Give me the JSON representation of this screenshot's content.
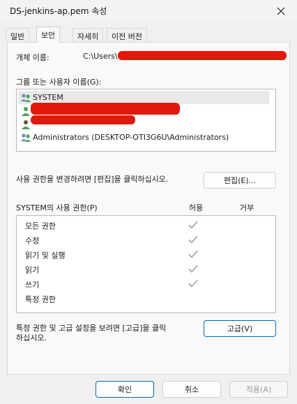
{
  "window": {
    "title": "DS-jenkins-ap.pem 속성"
  },
  "tabs": [
    {
      "label": "일반",
      "active": false
    },
    {
      "label": "보안",
      "active": true
    },
    {
      "label": "자세히",
      "active": false
    },
    {
      "label": "이전 버전",
      "active": false
    }
  ],
  "object_name": {
    "label": "개체 이름:",
    "value": "C:\\Users\\"
  },
  "groups": {
    "label": "그룹 또는 사용자 이름(G):",
    "items": [
      {
        "name": "SYSTEM",
        "icon": "group-icon",
        "selected": true
      },
      {
        "name": "",
        "icon": "user-icon",
        "redacted": true
      },
      {
        "name": "",
        "icon": "user-icon",
        "redacted": true
      },
      {
        "name": "Administrators (DESKTOP-OTI3G6U\\Administrators)",
        "icon": "group-icon",
        "selected": false
      }
    ]
  },
  "edit": {
    "hint": "사용 권한을 변경하려면 [편집]을 클릭하십시오.",
    "button": "편집(E)..."
  },
  "permissions": {
    "title": "SYSTEM의 사용 권한(P)",
    "allow_header": "허용",
    "deny_header": "거부",
    "rows": [
      {
        "label": "모든 권한",
        "allow": true,
        "deny": false
      },
      {
        "label": "수정",
        "allow": true,
        "deny": false
      },
      {
        "label": "읽기 및 실행",
        "allow": true,
        "deny": false
      },
      {
        "label": "읽기",
        "allow": true,
        "deny": false
      },
      {
        "label": "쓰기",
        "allow": true,
        "deny": false
      },
      {
        "label": "특정 권한",
        "allow": false,
        "deny": false
      }
    ]
  },
  "advanced": {
    "hint_line1": "특정 권한 및 고급 설정을 보려면 [고급]을 클릭",
    "hint_line2": "하십시오.",
    "button": "고급(V)"
  },
  "footer": {
    "ok": "확인",
    "cancel": "취소",
    "apply": "적용(A)"
  },
  "colors": {
    "accent": "#0067c0",
    "check_gray": "#9e9e9e",
    "redaction": "#e3170a"
  }
}
